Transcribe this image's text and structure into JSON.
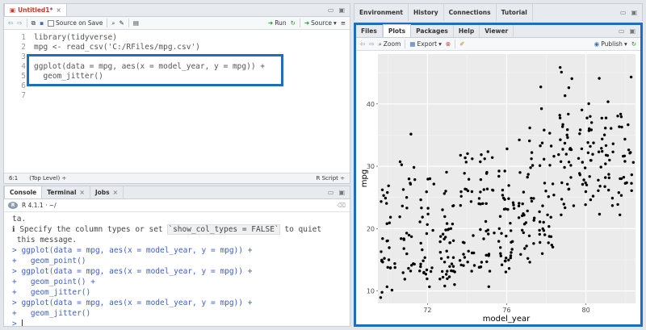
{
  "source": {
    "tab_name": "Untitled1*",
    "source_on_save": "Source on Save",
    "run_label": "Run",
    "source_label": "Source",
    "lines": [
      {
        "n": "1",
        "code": "library(tidyverse)"
      },
      {
        "n": "2",
        "code": "mpg <- read_csv('C:/RFiles/mpg.csv')"
      },
      {
        "n": "3",
        "code": ""
      },
      {
        "n": "4",
        "code": "ggplot(data = mpg, aes(x = model_year, y = mpg)) +"
      },
      {
        "n": "5",
        "code": "  geom_jitter()"
      },
      {
        "n": "6",
        "code": ""
      },
      {
        "n": "7",
        "code": ""
      }
    ],
    "status_pos": "6:1",
    "status_scope": "(Top Level) ÷",
    "status_type": "R Script ÷"
  },
  "console": {
    "tabs": [
      "Console",
      "Terminal",
      "Jobs"
    ],
    "r_version": "R 4.1.1 · ~/",
    "lines": [
      {
        "cls": "msg",
        "t": "ta."
      },
      {
        "cls": "msg",
        "t": "ℹ Specify the column types or set "
      },
      {
        "cls": "msg",
        "t": " this message."
      },
      {
        "cls": "cmd",
        "t": "> ggplot(data = mpg, aes(x = model_year, y = mpg)) +"
      },
      {
        "cls": "cmd",
        "t": "+   geom_point()"
      },
      {
        "cls": "cmd",
        "t": "> ggplot(data = mpg, aes(x = model_year, y = mpg)) +"
      },
      {
        "cls": "cmd",
        "t": "+   geom_point() +"
      },
      {
        "cls": "cmd",
        "t": "+   geom_jitter()"
      },
      {
        "cls": "cmd",
        "t": "> ggplot(data = mpg, aes(x = model_year, y = mpg)) +"
      },
      {
        "cls": "cmd",
        "t": "+   geom_jitter()"
      },
      {
        "cls": "cmd",
        "t": "> "
      }
    ],
    "highlight": "`show_col_types = FALSE`",
    "after_highlight": " to quiet"
  },
  "env": {
    "tabs": [
      "Environment",
      "History",
      "Connections",
      "Tutorial"
    ]
  },
  "files": {
    "tabs": [
      "Files",
      "Plots",
      "Packages",
      "Help",
      "Viewer"
    ],
    "active": "Plots",
    "zoom": "Zoom",
    "export": "Export",
    "publish": "Publish"
  },
  "chart_data": {
    "type": "scatter",
    "xlabel": "model_year",
    "ylabel": "mpg",
    "xlim": [
      69.5,
      82.5
    ],
    "ylim": [
      8,
      48
    ],
    "xticks": [
      72,
      76,
      80
    ],
    "yticks": [
      10,
      20,
      30,
      40
    ],
    "grid": true,
    "points": [
      [
        70,
        18
      ],
      [
        70,
        15
      ],
      [
        70,
        18
      ],
      [
        70,
        16
      ],
      [
        70,
        17
      ],
      [
        70,
        15
      ],
      [
        70,
        14
      ],
      [
        70,
        14
      ],
      [
        70,
        14
      ],
      [
        70,
        15
      ],
      [
        70,
        15
      ],
      [
        70,
        14
      ],
      [
        70,
        15
      ],
      [
        70,
        14
      ],
      [
        70,
        24
      ],
      [
        70,
        22
      ],
      [
        70,
        18
      ],
      [
        70,
        21
      ],
      [
        70,
        27
      ],
      [
        70,
        26
      ],
      [
        70,
        25
      ],
      [
        70,
        24
      ],
      [
        70,
        25
      ],
      [
        70,
        26
      ],
      [
        70,
        21
      ],
      [
        70,
        10
      ],
      [
        70,
        10
      ],
      [
        70,
        11
      ],
      [
        70,
        9
      ],
      [
        71,
        27
      ],
      [
        71,
        28
      ],
      [
        71,
        25
      ],
      [
        71,
        19
      ],
      [
        71,
        16
      ],
      [
        71,
        17
      ],
      [
        71,
        19
      ],
      [
        71,
        18
      ],
      [
        71,
        14
      ],
      [
        71,
        14
      ],
      [
        71,
        14
      ],
      [
        71,
        14
      ],
      [
        71,
        12
      ],
      [
        71,
        13
      ],
      [
        71,
        13
      ],
      [
        71,
        18
      ],
      [
        71,
        22
      ],
      [
        71,
        19
      ],
      [
        71,
        18
      ],
      [
        71,
        23
      ],
      [
        71,
        28
      ],
      [
        71,
        30
      ],
      [
        71,
        30
      ],
      [
        71,
        31
      ],
      [
        71,
        35
      ],
      [
        71,
        27
      ],
      [
        71,
        26
      ],
      [
        71,
        24
      ],
      [
        72,
        25
      ],
      [
        72,
        23
      ],
      [
        72,
        20
      ],
      [
        72,
        21
      ],
      [
        72,
        13
      ],
      [
        72,
        14
      ],
      [
        72,
        15
      ],
      [
        72,
        14
      ],
      [
        72,
        17
      ],
      [
        72,
        11
      ],
      [
        72,
        13
      ],
      [
        72,
        12
      ],
      [
        72,
        13
      ],
      [
        72,
        19
      ],
      [
        72,
        15
      ],
      [
        72,
        13
      ],
      [
        72,
        13
      ],
      [
        72,
        14
      ],
      [
        72,
        18
      ],
      [
        72,
        22
      ],
      [
        72,
        21
      ],
      [
        72,
        26
      ],
      [
        72,
        22
      ],
      [
        72,
        28
      ],
      [
        72,
        23
      ],
      [
        72,
        28
      ],
      [
        72,
        27
      ],
      [
        72,
        13
      ],
      [
        73,
        14
      ],
      [
        73,
        13
      ],
      [
        73,
        14
      ],
      [
        73,
        15
      ],
      [
        73,
        12
      ],
      [
        73,
        13
      ],
      [
        73,
        13
      ],
      [
        73,
        14
      ],
      [
        73,
        13
      ],
      [
        73,
        12
      ],
      [
        73,
        13
      ],
      [
        73,
        18
      ],
      [
        73,
        16
      ],
      [
        73,
        18
      ],
      [
        73,
        18
      ],
      [
        73,
        23
      ],
      [
        73,
        26
      ],
      [
        73,
        11
      ],
      [
        73,
        12
      ],
      [
        73,
        13
      ],
      [
        73,
        12
      ],
      [
        73,
        18
      ],
      [
        73,
        20
      ],
      [
        73,
        21
      ],
      [
        73,
        22
      ],
      [
        73,
        18
      ],
      [
        73,
        19
      ],
      [
        73,
        21
      ],
      [
        73,
        26
      ],
      [
        73,
        15
      ],
      [
        73,
        16
      ],
      [
        73,
        29
      ],
      [
        73,
        24
      ],
      [
        73,
        20
      ],
      [
        73,
        19
      ],
      [
        73,
        15
      ],
      [
        73,
        24
      ],
      [
        73,
        20
      ],
      [
        73,
        11
      ],
      [
        73,
        20
      ],
      [
        73,
        19
      ],
      [
        73,
        15
      ],
      [
        74,
        31
      ],
      [
        74,
        26
      ],
      [
        74,
        32
      ],
      [
        74,
        25
      ],
      [
        74,
        16
      ],
      [
        74,
        16
      ],
      [
        74,
        18
      ],
      [
        74,
        16
      ],
      [
        74,
        13
      ],
      [
        74,
        14
      ],
      [
        74,
        14
      ],
      [
        74,
        14
      ],
      [
        74,
        29
      ],
      [
        74,
        26
      ],
      [
        74,
        26
      ],
      [
        74,
        31
      ],
      [
        74,
        32
      ],
      [
        74,
        28
      ],
      [
        74,
        24
      ],
      [
        74,
        26
      ],
      [
        74,
        24
      ],
      [
        74,
        26
      ],
      [
        74,
        31
      ],
      [
        74,
        19
      ],
      [
        74,
        18
      ],
      [
        74,
        15
      ],
      [
        74,
        15
      ],
      [
        74,
        16
      ],
      [
        74,
        15
      ],
      [
        75,
        16
      ],
      [
        75,
        29
      ],
      [
        75,
        24
      ],
      [
        75,
        20
      ],
      [
        75,
        19
      ],
      [
        75,
        15
      ],
      [
        75,
        24
      ],
      [
        75,
        20
      ],
      [
        75,
        11
      ],
      [
        75,
        20
      ],
      [
        75,
        21
      ],
      [
        75,
        19
      ],
      [
        75,
        15
      ],
      [
        75,
        31
      ],
      [
        75,
        26
      ],
      [
        75,
        32
      ],
      [
        75,
        25
      ],
      [
        75,
        16
      ],
      [
        75,
        16
      ],
      [
        75,
        18
      ],
      [
        75,
        16
      ],
      [
        75,
        13
      ],
      [
        75,
        14
      ],
      [
        75,
        14
      ],
      [
        75,
        14
      ],
      [
        75,
        29
      ],
      [
        75,
        26
      ],
      [
        75,
        26
      ],
      [
        75,
        31
      ],
      [
        75,
        32
      ],
      [
        75,
        28
      ],
      [
        75,
        24
      ],
      [
        75,
        26
      ],
      [
        75,
        24
      ],
      [
        75,
        26
      ],
      [
        75,
        31
      ],
      [
        76,
        19
      ],
      [
        76,
        18
      ],
      [
        76,
        15
      ],
      [
        76,
        15
      ],
      [
        76,
        16
      ],
      [
        76,
        15
      ],
      [
        76,
        16
      ],
      [
        76,
        14
      ],
      [
        76,
        17
      ],
      [
        76,
        16
      ],
      [
        76,
        15
      ],
      [
        76,
        18
      ],
      [
        76,
        21
      ],
      [
        76,
        20
      ],
      [
        76,
        13
      ],
      [
        76,
        29
      ],
      [
        76,
        23
      ],
      [
        76,
        20
      ],
      [
        76,
        23
      ],
      [
        76,
        24
      ],
      [
        76,
        25
      ],
      [
        76,
        24
      ],
      [
        76,
        18
      ],
      [
        76,
        29
      ],
      [
        76,
        19
      ],
      [
        76,
        23
      ],
      [
        76,
        23
      ],
      [
        76,
        22
      ],
      [
        76,
        25
      ],
      [
        76,
        33
      ],
      [
        76,
        28
      ],
      [
        76,
        25
      ],
      [
        76,
        25
      ],
      [
        76,
        26
      ],
      [
        76,
        27
      ],
      [
        76,
        17
      ],
      [
        76,
        16
      ],
      [
        76,
        15
      ],
      [
        76,
        14
      ],
      [
        77,
        22
      ],
      [
        77,
        22
      ],
      [
        77,
        24
      ],
      [
        77,
        22
      ],
      [
        77,
        29
      ],
      [
        77,
        24
      ],
      [
        77,
        29
      ],
      [
        77,
        24
      ],
      [
        77,
        36
      ],
      [
        77,
        25
      ],
      [
        77,
        30
      ],
      [
        77,
        15
      ],
      [
        77,
        16
      ],
      [
        77,
        17
      ],
      [
        77,
        15
      ],
      [
        77,
        21
      ],
      [
        77,
        20
      ],
      [
        77,
        19
      ],
      [
        77,
        25
      ],
      [
        77,
        17
      ],
      [
        77,
        19
      ],
      [
        77,
        18
      ],
      [
        77,
        26
      ],
      [
        77,
        24
      ],
      [
        77,
        30
      ],
      [
        77,
        22
      ],
      [
        77,
        28
      ],
      [
        77,
        23
      ],
      [
        77,
        31
      ],
      [
        77,
        32
      ],
      [
        77,
        34
      ],
      [
        77,
        34
      ],
      [
        77,
        22
      ],
      [
        77,
        21
      ],
      [
        77,
        21
      ],
      [
        78,
        36
      ],
      [
        78,
        34
      ],
      [
        78,
        43
      ],
      [
        78,
        20
      ],
      [
        78,
        20
      ],
      [
        78,
        19
      ],
      [
        78,
        20
      ],
      [
        78,
        21
      ],
      [
        78,
        21
      ],
      [
        78,
        19
      ],
      [
        78,
        17
      ],
      [
        78,
        19
      ],
      [
        78,
        18
      ],
      [
        78,
        17
      ],
      [
        78,
        16
      ],
      [
        78,
        23
      ],
      [
        78,
        25
      ],
      [
        78,
        39
      ],
      [
        78,
        35
      ],
      [
        78,
        31
      ],
      [
        78,
        22
      ],
      [
        78,
        27
      ],
      [
        78,
        27
      ],
      [
        78,
        30
      ],
      [
        78,
        32
      ],
      [
        78,
        30
      ],
      [
        78,
        25
      ],
      [
        78,
        24
      ],
      [
        78,
        22
      ],
      [
        78,
        20
      ],
      [
        78,
        18
      ],
      [
        78,
        19
      ],
      [
        78,
        33
      ],
      [
        78,
        33
      ],
      [
        78,
        26
      ],
      [
        79,
        31
      ],
      [
        79,
        33
      ],
      [
        79,
        34
      ],
      [
        79,
        43
      ],
      [
        79,
        45
      ],
      [
        79,
        46
      ],
      [
        79,
        41
      ],
      [
        79,
        35
      ],
      [
        79,
        33
      ],
      [
        79,
        37
      ],
      [
        79,
        38
      ],
      [
        79,
        30
      ],
      [
        79,
        35
      ],
      [
        79,
        27
      ],
      [
        79,
        24
      ],
      [
        79,
        26
      ],
      [
        79,
        25
      ],
      [
        79,
        24
      ],
      [
        79,
        33
      ],
      [
        79,
        34
      ],
      [
        79,
        27
      ],
      [
        79,
        23
      ],
      [
        79,
        31
      ],
      [
        79,
        32
      ],
      [
        79,
        28
      ],
      [
        79,
        30
      ],
      [
        79,
        38
      ],
      [
        79,
        36
      ],
      [
        79,
        38
      ],
      [
        79,
        26
      ],
      [
        79,
        22
      ],
      [
        79,
        32
      ],
      [
        79,
        36
      ],
      [
        79,
        44
      ],
      [
        79,
        33
      ],
      [
        80,
        36
      ],
      [
        80,
        32
      ],
      [
        80,
        33
      ],
      [
        80,
        36
      ],
      [
        80,
        37
      ],
      [
        80,
        31
      ],
      [
        80,
        38
      ],
      [
        80,
        36
      ],
      [
        80,
        36
      ],
      [
        80,
        35
      ],
      [
        80,
        32
      ],
      [
        80,
        31
      ],
      [
        80,
        34
      ],
      [
        80,
        30
      ],
      [
        80,
        26
      ],
      [
        80,
        27
      ],
      [
        80,
        28
      ],
      [
        80,
        31
      ],
      [
        80,
        34
      ],
      [
        80,
        29
      ],
      [
        80,
        25
      ],
      [
        80,
        24
      ],
      [
        80,
        25
      ],
      [
        80,
        29
      ],
      [
        80,
        27
      ],
      [
        80,
        27
      ],
      [
        80,
        31
      ],
      [
        80,
        38
      ],
      [
        80,
        39
      ],
      [
        80,
        40
      ],
      [
        80,
        33
      ],
      [
        80,
        28
      ],
      [
        81,
        32
      ],
      [
        81,
        28
      ],
      [
        81,
        34
      ],
      [
        81,
        27
      ],
      [
        81,
        28
      ],
      [
        81,
        32
      ],
      [
        81,
        30
      ],
      [
        81,
        24
      ],
      [
        81,
        28
      ],
      [
        81,
        32
      ],
      [
        81,
        26
      ],
      [
        81,
        25
      ],
      [
        81,
        32
      ],
      [
        81,
        22
      ],
      [
        81,
        33
      ],
      [
        81,
        30
      ],
      [
        81,
        33
      ],
      [
        81,
        34
      ],
      [
        81,
        35
      ],
      [
        81,
        38
      ],
      [
        81,
        36
      ],
      [
        81,
        38
      ],
      [
        81,
        40
      ],
      [
        81,
        44
      ],
      [
        81,
        36
      ],
      [
        81,
        26
      ],
      [
        81,
        27
      ],
      [
        81,
        29
      ],
      [
        81,
        31
      ],
      [
        81,
        32
      ],
      [
        82,
        32
      ],
      [
        82,
        36
      ],
      [
        82,
        27
      ],
      [
        82,
        28
      ],
      [
        82,
        31
      ],
      [
        82,
        38
      ],
      [
        82,
        26
      ],
      [
        82,
        22
      ],
      [
        82,
        32
      ],
      [
        82,
        36
      ],
      [
        82,
        27
      ],
      [
        82,
        27
      ],
      [
        82,
        44
      ],
      [
        82,
        32
      ],
      [
        82,
        28
      ],
      [
        82,
        31
      ],
      [
        82,
        34
      ],
      [
        82,
        37
      ],
      [
        82,
        38
      ],
      [
        82,
        32
      ],
      [
        82,
        38
      ],
      [
        82,
        25
      ],
      [
        82,
        26
      ],
      [
        82,
        28
      ],
      [
        82,
        24
      ],
      [
        82,
        33
      ],
      [
        82,
        29
      ]
    ]
  }
}
